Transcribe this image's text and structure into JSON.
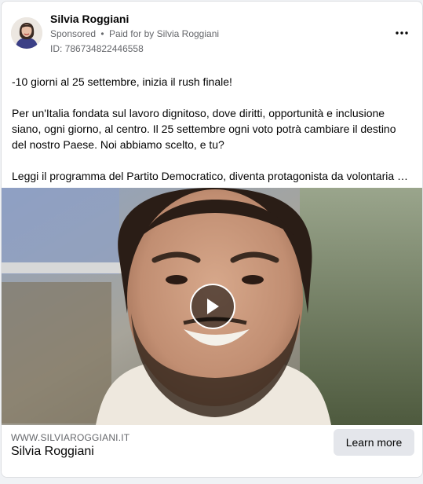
{
  "post": {
    "page_name": "Silvia Roggiani",
    "sponsored_label": "Sponsored",
    "separator": "•",
    "paid_for_prefix": "Paid for by",
    "paid_for_name": "Silvia Roggiani",
    "ad_id": "ID: 786734822446558",
    "more_icon": "more-horizontal-icon"
  },
  "body": {
    "paragraphs": [
      "-10 giorni al 25 settembre, inizia il rush finale!",
      "Per un'Italia fondata sul lavoro dignitoso, dove diritti, opportunità e inclusione siano, ogni giorno, al centro. Il 25 settembre ogni voto potrà cambiare il destino del nostro Paese. Noi abbiamo scelto, e tu?",
      "Leggi il programma del Partito Democratico, diventa protagonista da volontaria o volontario"
    ]
  },
  "media": {
    "type": "video",
    "play_icon": "play-icon"
  },
  "footer": {
    "domain": "WWW.SILVIAROGGIANI.IT",
    "title": "Silvia Roggiani",
    "cta_label": "Learn more"
  },
  "colors": {
    "secondary_text": "#65676b",
    "button_bg": "#e4e6eb",
    "card_border": "#dddfe2"
  }
}
